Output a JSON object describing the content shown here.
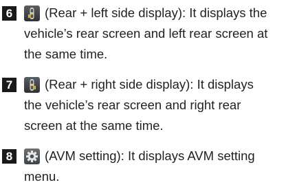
{
  "items": [
    {
      "number": "6",
      "icon": "rear-left-camera-icon",
      "lines": [
        "(Rear + left side display): It displays the",
        "vehicle’s rear screen and left rear screen at",
        "the same time."
      ]
    },
    {
      "number": "7",
      "icon": "rear-right-camera-icon",
      "lines": [
        "(Rear + right side display): It displays",
        "the vehicle’s rear screen and right rear",
        "screen at the same time."
      ]
    },
    {
      "number": "8",
      "icon": "gear-icon",
      "lines": [
        "(AVM setting): It displays AVM setting",
        "menu."
      ]
    }
  ],
  "colors": {
    "text": "#231f20",
    "badge": "#1a1a1a",
    "icon_highlight": "#f2c200"
  }
}
